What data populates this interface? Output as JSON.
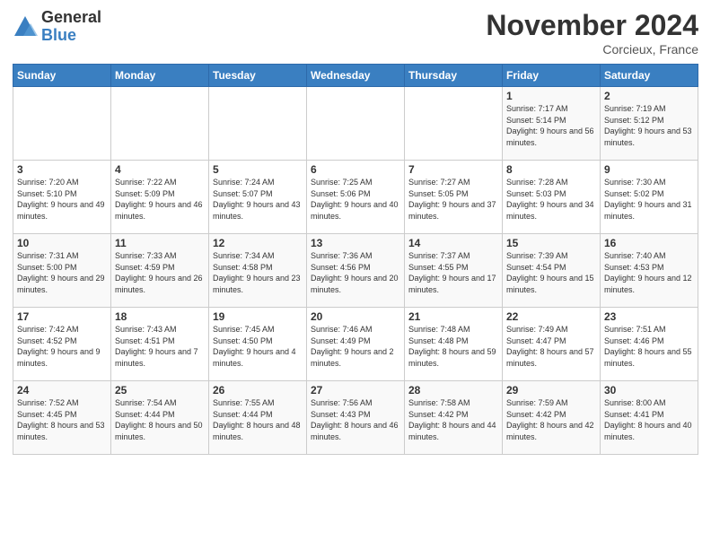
{
  "logo": {
    "general": "General",
    "blue": "Blue"
  },
  "title": "November 2024",
  "location": "Corcieux, France",
  "days_of_week": [
    "Sunday",
    "Monday",
    "Tuesday",
    "Wednesday",
    "Thursday",
    "Friday",
    "Saturday"
  ],
  "weeks": [
    [
      {
        "day": "",
        "info": ""
      },
      {
        "day": "",
        "info": ""
      },
      {
        "day": "",
        "info": ""
      },
      {
        "day": "",
        "info": ""
      },
      {
        "day": "",
        "info": ""
      },
      {
        "day": "1",
        "info": "Sunrise: 7:17 AM\nSunset: 5:14 PM\nDaylight: 9 hours and 56 minutes."
      },
      {
        "day": "2",
        "info": "Sunrise: 7:19 AM\nSunset: 5:12 PM\nDaylight: 9 hours and 53 minutes."
      }
    ],
    [
      {
        "day": "3",
        "info": "Sunrise: 7:20 AM\nSunset: 5:10 PM\nDaylight: 9 hours and 49 minutes."
      },
      {
        "day": "4",
        "info": "Sunrise: 7:22 AM\nSunset: 5:09 PM\nDaylight: 9 hours and 46 minutes."
      },
      {
        "day": "5",
        "info": "Sunrise: 7:24 AM\nSunset: 5:07 PM\nDaylight: 9 hours and 43 minutes."
      },
      {
        "day": "6",
        "info": "Sunrise: 7:25 AM\nSunset: 5:06 PM\nDaylight: 9 hours and 40 minutes."
      },
      {
        "day": "7",
        "info": "Sunrise: 7:27 AM\nSunset: 5:05 PM\nDaylight: 9 hours and 37 minutes."
      },
      {
        "day": "8",
        "info": "Sunrise: 7:28 AM\nSunset: 5:03 PM\nDaylight: 9 hours and 34 minutes."
      },
      {
        "day": "9",
        "info": "Sunrise: 7:30 AM\nSunset: 5:02 PM\nDaylight: 9 hours and 31 minutes."
      }
    ],
    [
      {
        "day": "10",
        "info": "Sunrise: 7:31 AM\nSunset: 5:00 PM\nDaylight: 9 hours and 29 minutes."
      },
      {
        "day": "11",
        "info": "Sunrise: 7:33 AM\nSunset: 4:59 PM\nDaylight: 9 hours and 26 minutes."
      },
      {
        "day": "12",
        "info": "Sunrise: 7:34 AM\nSunset: 4:58 PM\nDaylight: 9 hours and 23 minutes."
      },
      {
        "day": "13",
        "info": "Sunrise: 7:36 AM\nSunset: 4:56 PM\nDaylight: 9 hours and 20 minutes."
      },
      {
        "day": "14",
        "info": "Sunrise: 7:37 AM\nSunset: 4:55 PM\nDaylight: 9 hours and 17 minutes."
      },
      {
        "day": "15",
        "info": "Sunrise: 7:39 AM\nSunset: 4:54 PM\nDaylight: 9 hours and 15 minutes."
      },
      {
        "day": "16",
        "info": "Sunrise: 7:40 AM\nSunset: 4:53 PM\nDaylight: 9 hours and 12 minutes."
      }
    ],
    [
      {
        "day": "17",
        "info": "Sunrise: 7:42 AM\nSunset: 4:52 PM\nDaylight: 9 hours and 9 minutes."
      },
      {
        "day": "18",
        "info": "Sunrise: 7:43 AM\nSunset: 4:51 PM\nDaylight: 9 hours and 7 minutes."
      },
      {
        "day": "19",
        "info": "Sunrise: 7:45 AM\nSunset: 4:50 PM\nDaylight: 9 hours and 4 minutes."
      },
      {
        "day": "20",
        "info": "Sunrise: 7:46 AM\nSunset: 4:49 PM\nDaylight: 9 hours and 2 minutes."
      },
      {
        "day": "21",
        "info": "Sunrise: 7:48 AM\nSunset: 4:48 PM\nDaylight: 8 hours and 59 minutes."
      },
      {
        "day": "22",
        "info": "Sunrise: 7:49 AM\nSunset: 4:47 PM\nDaylight: 8 hours and 57 minutes."
      },
      {
        "day": "23",
        "info": "Sunrise: 7:51 AM\nSunset: 4:46 PM\nDaylight: 8 hours and 55 minutes."
      }
    ],
    [
      {
        "day": "24",
        "info": "Sunrise: 7:52 AM\nSunset: 4:45 PM\nDaylight: 8 hours and 53 minutes."
      },
      {
        "day": "25",
        "info": "Sunrise: 7:54 AM\nSunset: 4:44 PM\nDaylight: 8 hours and 50 minutes."
      },
      {
        "day": "26",
        "info": "Sunrise: 7:55 AM\nSunset: 4:44 PM\nDaylight: 8 hours and 48 minutes."
      },
      {
        "day": "27",
        "info": "Sunrise: 7:56 AM\nSunset: 4:43 PM\nDaylight: 8 hours and 46 minutes."
      },
      {
        "day": "28",
        "info": "Sunrise: 7:58 AM\nSunset: 4:42 PM\nDaylight: 8 hours and 44 minutes."
      },
      {
        "day": "29",
        "info": "Sunrise: 7:59 AM\nSunset: 4:42 PM\nDaylight: 8 hours and 42 minutes."
      },
      {
        "day": "30",
        "info": "Sunrise: 8:00 AM\nSunset: 4:41 PM\nDaylight: 8 hours and 40 minutes."
      }
    ]
  ]
}
